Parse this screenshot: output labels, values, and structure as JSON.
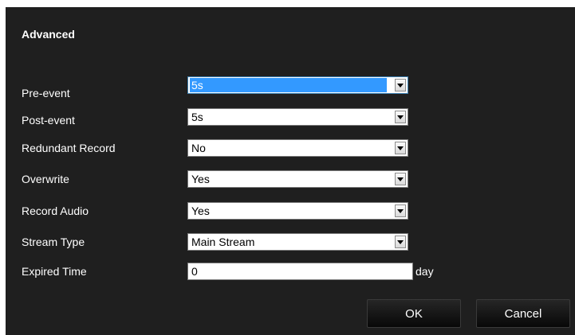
{
  "dialog": {
    "title": "Advanced",
    "ok_label": "OK",
    "cancel_label": "Cancel"
  },
  "fields": {
    "pre_event": {
      "label": "Pre-event",
      "value": "5s",
      "focused": true
    },
    "post_event": {
      "label": "Post-event",
      "value": "5s"
    },
    "redundant_record": {
      "label": "Redundant Record",
      "value": "No"
    },
    "overwrite": {
      "label": "Overwrite",
      "value": "Yes"
    },
    "record_audio": {
      "label": "Record Audio",
      "value": "Yes"
    },
    "stream_type": {
      "label": "Stream Type",
      "value": "Main Stream"
    },
    "expired_time": {
      "label": "Expired Time",
      "value": "0",
      "unit": "day"
    }
  },
  "icons": {
    "dropdown": "chevron-down-icon"
  },
  "colors": {
    "dialog_background": "#1f1f1f",
    "selection_highlight": "#3399ff",
    "text": "#ffffff"
  }
}
